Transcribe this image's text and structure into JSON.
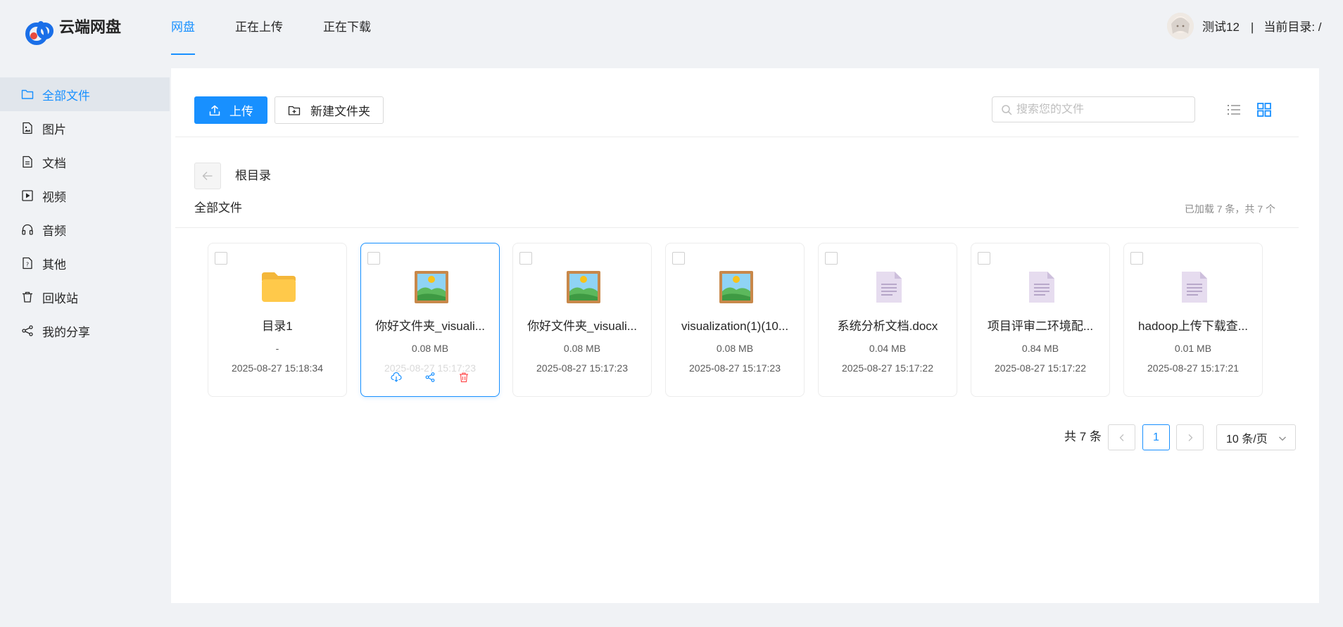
{
  "header": {
    "app_title": "云端网盘",
    "tabs": [
      {
        "label": "网盘",
        "active": true
      },
      {
        "label": "正在上传",
        "active": false
      },
      {
        "label": "正在下载",
        "active": false
      }
    ],
    "user_name": "测试12",
    "separator": "|",
    "current_dir": "当前目录: /"
  },
  "sidebar": {
    "items": [
      {
        "label": "全部文件",
        "icon": "folder-icon",
        "active": true
      },
      {
        "label": "图片",
        "icon": "image-file-icon",
        "active": false
      },
      {
        "label": "文档",
        "icon": "document-icon",
        "active": false
      },
      {
        "label": "视频",
        "icon": "video-icon",
        "active": false
      },
      {
        "label": "音频",
        "icon": "headphones-icon",
        "active": false
      },
      {
        "label": "其他",
        "icon": "unknown-file-icon",
        "active": false
      },
      {
        "label": "回收站",
        "icon": "trash-icon",
        "active": false
      },
      {
        "label": "我的分享",
        "icon": "share-icon",
        "active": false
      }
    ]
  },
  "toolbar": {
    "upload_label": "上传",
    "new_folder_label": "新建文件夹",
    "search_placeholder": "搜索您的文件"
  },
  "breadcrumb": {
    "current": "根目录"
  },
  "section": {
    "title": "全部文件",
    "loaded_info": "已加载 7 条，共 7 个"
  },
  "files": [
    {
      "name": "目录1",
      "size": "-",
      "date": "2025-08-27 15:18:34",
      "type": "folder",
      "selected": false
    },
    {
      "name": "你好文件夹_visuali...",
      "size": "0.08 MB",
      "date": "2025-08-27 15:17:23",
      "type": "image",
      "selected": true
    },
    {
      "name": "你好文件夹_visuali...",
      "size": "0.08 MB",
      "date": "2025-08-27 15:17:23",
      "type": "image",
      "selected": false
    },
    {
      "name": "visualization(1)(10...",
      "size": "0.08 MB",
      "date": "2025-08-27 15:17:23",
      "type": "image",
      "selected": false
    },
    {
      "name": "系统分析文档.docx",
      "size": "0.04 MB",
      "date": "2025-08-27 15:17:22",
      "type": "document",
      "selected": false
    },
    {
      "name": "项目评审二环境配...",
      "size": "0.84 MB",
      "date": "2025-08-27 15:17:22",
      "type": "document",
      "selected": false
    },
    {
      "name": "hadoop上传下载查...",
      "size": "0.01 MB",
      "date": "2025-08-27 15:17:21",
      "type": "document",
      "selected": false
    }
  ],
  "pagination": {
    "total_label": "共 7 条",
    "current_page": "1",
    "page_size": "10 条/页"
  },
  "colors": {
    "accent": "#1890ff",
    "danger": "#ff4d4f",
    "background": "#f0f2f5"
  }
}
